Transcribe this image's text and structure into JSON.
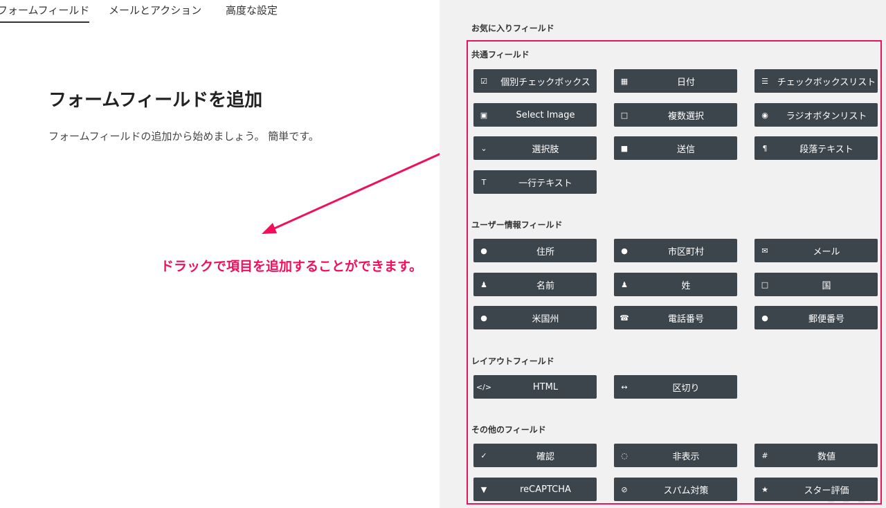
{
  "tabs": [
    {
      "label": "フォームフィールド",
      "active": true
    },
    {
      "label": "メールとアクション",
      "active": false
    },
    {
      "label": "高度な設定",
      "active": false
    }
  ],
  "main": {
    "title": "フォームフィールドを追加",
    "description": "フォームフィールドの追加から始めましょう。 簡単です。"
  },
  "annotation": {
    "text": "ドラックで項目を追加することができます。",
    "color": "#f0105a"
  },
  "panel": {
    "favorites_title": "お気に入りフィールド",
    "sections": [
      {
        "title": "共通フィールド",
        "items": [
          {
            "label": "個別チェックボックス",
            "icon": "check-square-icon",
            "glyph": "☑"
          },
          {
            "label": "日付",
            "icon": "calendar-icon",
            "glyph": "▦"
          },
          {
            "label": "チェックボックスリスト",
            "icon": "list-icon",
            "glyph": "☰"
          },
          {
            "label": "Select Image",
            "icon": "image-icon",
            "glyph": "▣"
          },
          {
            "label": "複数選択",
            "icon": "square-icon",
            "glyph": "□"
          },
          {
            "label": "ラジオボタンリスト",
            "icon": "radio-icon",
            "glyph": "◉"
          },
          {
            "label": "選択肢",
            "icon": "chevron-down-icon",
            "glyph": "⌄"
          },
          {
            "label": "送信",
            "icon": "solid-square-icon",
            "glyph": "■"
          },
          {
            "label": "段落テキスト",
            "icon": "paragraph-icon",
            "glyph": "¶"
          },
          {
            "label": "一行テキスト",
            "icon": "text-icon",
            "glyph": "T"
          }
        ]
      },
      {
        "title": "ユーザー情報フィールド",
        "items": [
          {
            "label": "住所",
            "icon": "map-marker-icon",
            "glyph": "●"
          },
          {
            "label": "市区町村",
            "icon": "map-marker-icon",
            "glyph": "●"
          },
          {
            "label": "メール",
            "icon": "envelope-icon",
            "glyph": "✉"
          },
          {
            "label": "名前",
            "icon": "user-icon",
            "glyph": "♟"
          },
          {
            "label": "姓",
            "icon": "user-icon",
            "glyph": "♟"
          },
          {
            "label": "国",
            "icon": "square-icon",
            "glyph": "□"
          },
          {
            "label": "米国州",
            "icon": "map-marker-icon",
            "glyph": "●"
          },
          {
            "label": "電話番号",
            "icon": "phone-icon",
            "glyph": "☎"
          },
          {
            "label": "郵便番号",
            "icon": "map-marker-icon",
            "glyph": "●"
          }
        ]
      },
      {
        "title": "レイアウトフィールド",
        "items": [
          {
            "label": "HTML",
            "icon": "code-icon",
            "glyph": "</>"
          },
          {
            "label": "区切り",
            "icon": "arrows-h-icon",
            "glyph": "↔"
          }
        ]
      },
      {
        "title": "その他のフィールド",
        "items": [
          {
            "label": "確認",
            "icon": "check-circle-icon",
            "glyph": "✓"
          },
          {
            "label": "非表示",
            "icon": "eye-slash-icon",
            "glyph": "◌"
          },
          {
            "label": "数値",
            "icon": "hash-icon",
            "glyph": "#"
          },
          {
            "label": "reCAPTCHA",
            "icon": "filter-icon",
            "glyph": "▼"
          },
          {
            "label": "スパム対策",
            "icon": "ban-icon",
            "glyph": "⊘"
          },
          {
            "label": "スター評価",
            "icon": "star-icon",
            "glyph": "★"
          }
        ]
      }
    ]
  },
  "colors": {
    "button_bg": "#3d454c",
    "frame_border": "#e8155c",
    "panel_bg": "#f1f1f1"
  }
}
